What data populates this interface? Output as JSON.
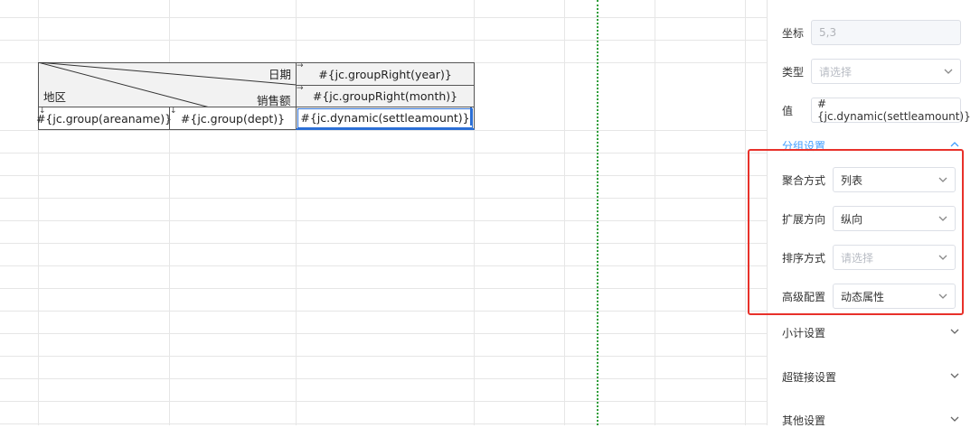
{
  "table": {
    "header_date": "日期",
    "header_sales": "销售额",
    "header_region": "地区",
    "year_cell": "#{jc.groupRight(year)}",
    "month_cell": "#{jc.groupRight(month)}",
    "area_cell": "#{jc.group(areaname)}",
    "dept_cell": "#{jc.group(dept)}",
    "amount_cell": "#{jc.dynamic(settleamount)}"
  },
  "panel": {
    "coord_label": "坐标",
    "coord_value": "5,3",
    "type_label": "类型",
    "type_placeholder": "请选择",
    "value_label": "值",
    "value_value": "#{jc.dynamic(settleamount)}",
    "group_section": "分组设置",
    "agg_label": "聚合方式",
    "agg_value": "列表",
    "expand_label": "扩展方向",
    "expand_value": "纵向",
    "sort_label": "排序方式",
    "sort_placeholder": "请选择",
    "adv_label": "高级配置",
    "adv_value": "动态属性",
    "subtotal_section": "小计设置",
    "link_section": "超链接设置",
    "other_section": "其他设置"
  },
  "colors": {
    "accent": "#409eff",
    "highlight_box": "#e8312a",
    "page_break": "#2f9e3a"
  }
}
